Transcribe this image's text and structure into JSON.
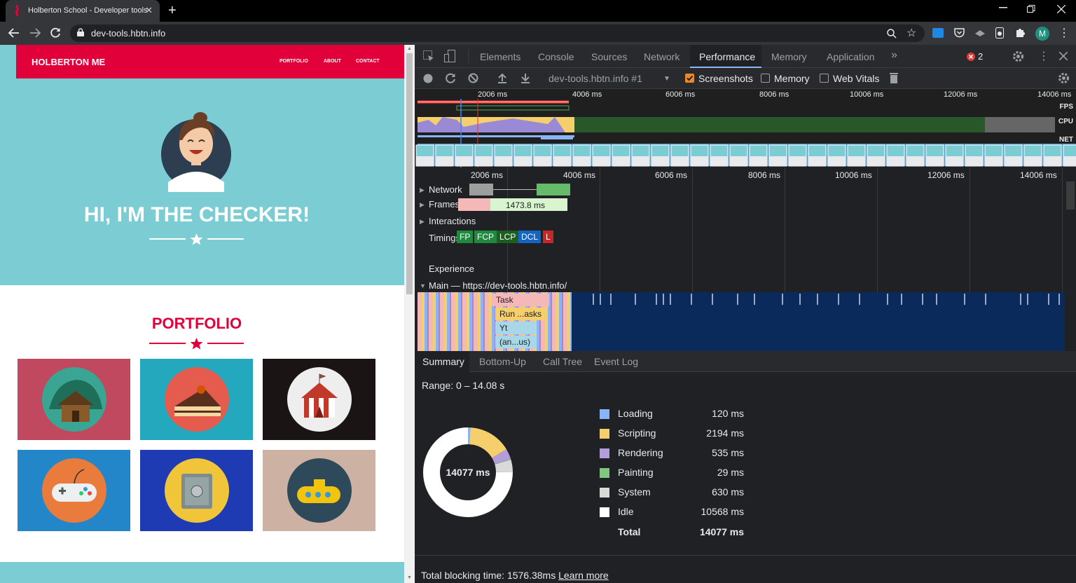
{
  "browser": {
    "tab_title": "Holberton School - Developer tools",
    "tab_close": "✕",
    "new_tab": "+",
    "url": "dev-tools.hbtn.info",
    "profile_initial": "M"
  },
  "site": {
    "brand": "HOLBERTON ME",
    "nav": [
      "PORTFOLIO",
      "ABOUT",
      "CONTACT"
    ],
    "hero_title": "HI, I'M THE CHECKER!",
    "portfolio_title": "PORTFOLIO",
    "tiles": [
      {
        "name": "cabin",
        "bg": "#c0485f",
        "circle": "#3aa592"
      },
      {
        "name": "cake",
        "bg": "#23a8bd",
        "circle": "#e55b4d"
      },
      {
        "name": "circus",
        "bg": "#1a1414",
        "circle": "#eeeeee"
      },
      {
        "name": "controller",
        "bg": "#2386c8",
        "circle": "#e97c3c"
      },
      {
        "name": "safe",
        "bg": "#1f3bb3",
        "circle": "#f0c53a"
      },
      {
        "name": "submarine",
        "bg": "#cdb2a4",
        "circle": "#2e4a5a"
      }
    ]
  },
  "devtools": {
    "tabs": [
      "Elements",
      "Console",
      "Sources",
      "Network",
      "Performance",
      "Memory",
      "Application"
    ],
    "more_tabs": "»",
    "error_count": "2",
    "recording_select": "dev-tools.hbtn.info #1",
    "checkboxes": [
      {
        "label": "Screenshots",
        "checked": true
      },
      {
        "label": "Memory",
        "checked": false
      },
      {
        "label": "Web Vitals",
        "checked": false
      }
    ],
    "overview_ticks": [
      "2006 ms",
      "4006 ms",
      "6006 ms",
      "8006 ms",
      "10006 ms",
      "12006 ms",
      "14006 ms"
    ],
    "overview_labels": [
      "FPS",
      "CPU",
      "NET"
    ],
    "track_ticks": [
      "2006 ms",
      "4006 ms",
      "6006 ms",
      "8006 ms",
      "10006 ms",
      "12006 ms",
      "14006 ms"
    ],
    "tracks": {
      "network": "Network",
      "frames": "Frames",
      "frame_duration": "1473.8 ms",
      "interactions": "Interactions",
      "timings": "Timings",
      "experience": "Experience",
      "main": "Main — https://dev-tools.hbtn.info/"
    },
    "timing_markers": [
      {
        "label": "FP",
        "color": "#1e8a3e"
      },
      {
        "label": "FCP",
        "color": "#1e8a3e"
      },
      {
        "label": "LCP",
        "color": "#1b5e20"
      },
      {
        "label": "DCL",
        "color": "#1565c0"
      },
      {
        "label": "L",
        "color": "#c62828"
      }
    ],
    "flame_labels": [
      "Task",
      "Run ...asks",
      "Yt",
      "(an...us)"
    ],
    "bottom_tabs": [
      "Summary",
      "Bottom-Up",
      "Call Tree",
      "Event Log"
    ],
    "range": "Range: 0 – 14.08 s",
    "donut_center": "14077 ms",
    "summary": [
      {
        "value": "120 ms",
        "name": "Loading",
        "color": "#8ab4f8",
        "ms": 120
      },
      {
        "value": "2194 ms",
        "name": "Scripting",
        "color": "#f4cf6b",
        "ms": 2194
      },
      {
        "value": "535 ms",
        "name": "Rendering",
        "color": "#b39ddb",
        "ms": 535
      },
      {
        "value": "29 ms",
        "name": "Painting",
        "color": "#81c784",
        "ms": 29
      },
      {
        "value": "630 ms",
        "name": "System",
        "color": "#d9d9d9",
        "ms": 630
      },
      {
        "value": "10568 ms",
        "name": "Idle",
        "color": "#ffffff",
        "ms": 10568
      }
    ],
    "total_value": "14077 ms",
    "total_label": "Total",
    "tbt_text": "Total blocking time: 1576.38ms",
    "tbt_link": "Learn more"
  }
}
